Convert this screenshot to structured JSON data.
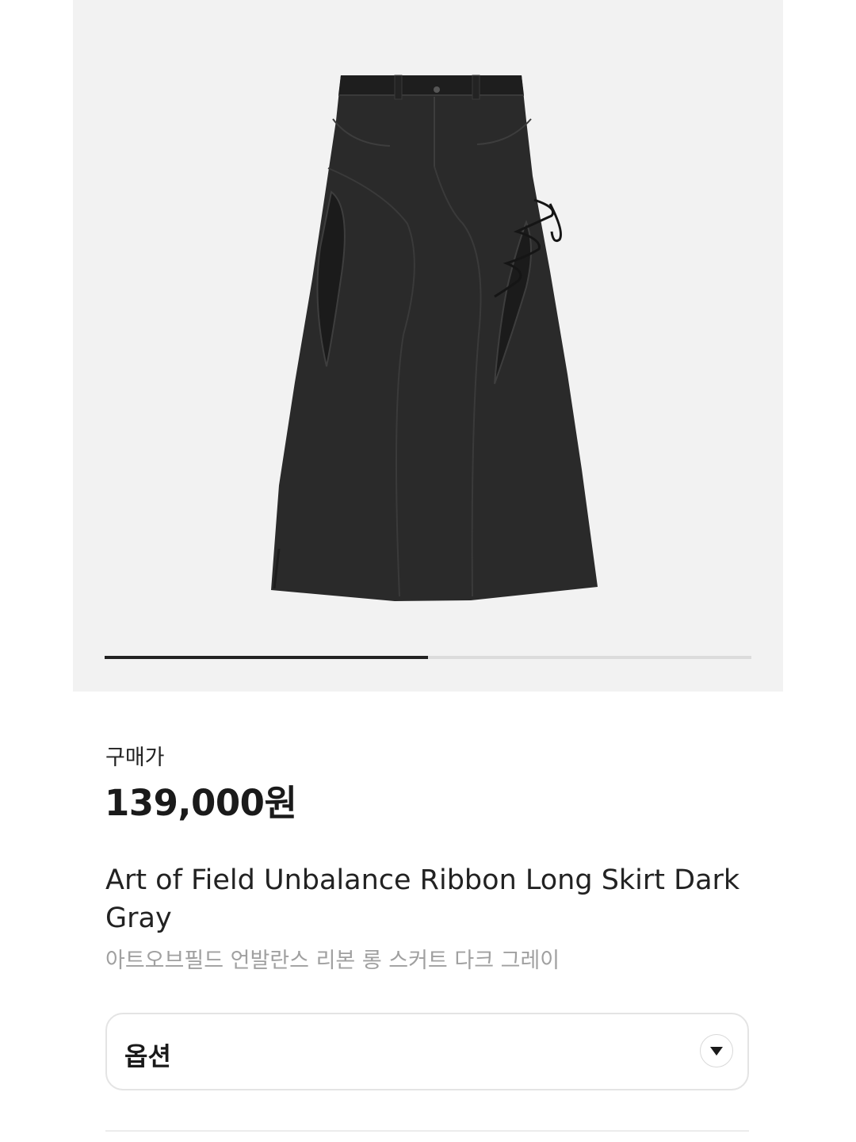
{
  "gallery": {
    "image_alt": "product-image",
    "progress": 0.5
  },
  "price": {
    "label": "구매가",
    "value": "139,000원"
  },
  "product": {
    "name_en": "Art of Field Unbalance Ribbon Long Skirt Dark Gray",
    "name_ko": "아트오브필드 언발란스 리본 롱 스커트 다크 그레이"
  },
  "option": {
    "label": "옵션",
    "icon": "chevron-down-icon"
  },
  "colors": {
    "gallery_bg": "#f2f2f2",
    "progress_fill": "#222222",
    "progress_track": "#dcdcdc",
    "subtitle_gray": "#a0a0a0"
  }
}
